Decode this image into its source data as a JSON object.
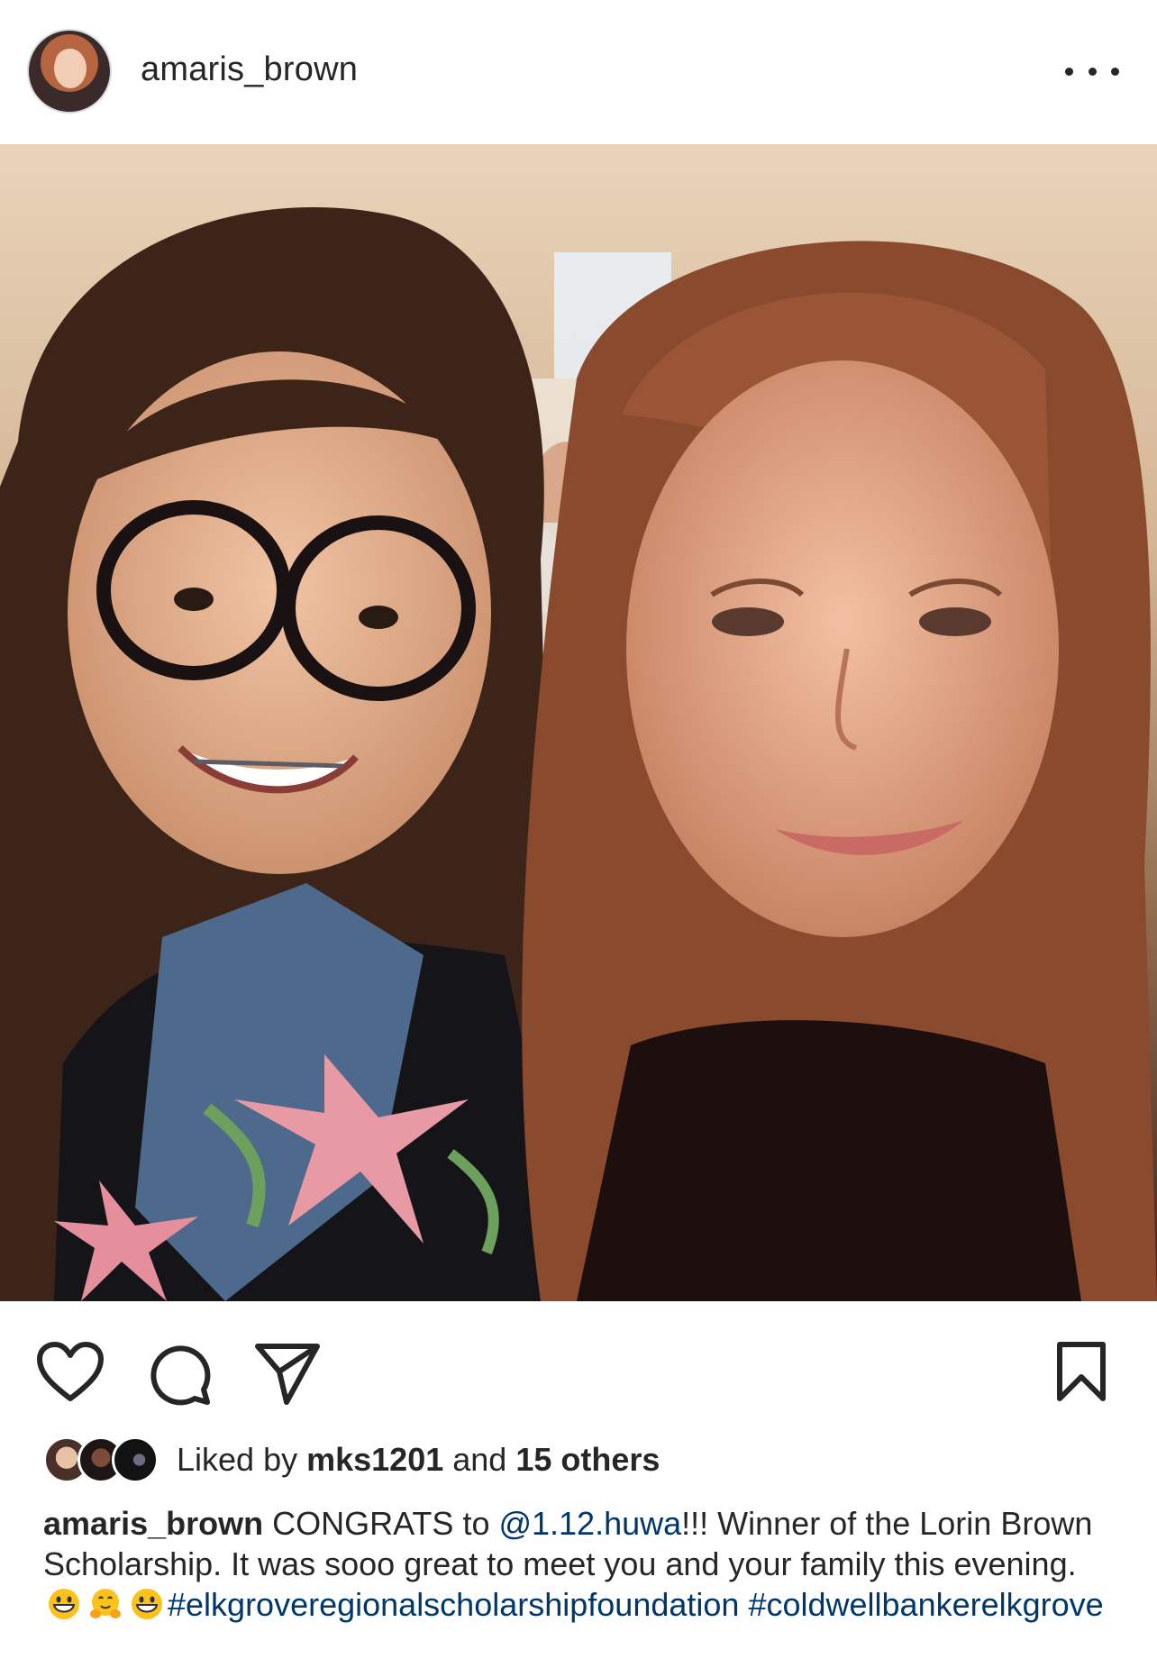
{
  "post": {
    "username": "amaris_brown",
    "avatar_icon": "profile-photo",
    "more_icon": "more-options-icon"
  },
  "photo": {
    "alt": "selfie photo"
  },
  "actions": {
    "like_icon": "heart-icon",
    "comment_icon": "comment-icon",
    "share_icon": "paper-plane-icon",
    "save_icon": "bookmark-icon"
  },
  "likes": {
    "prefix": "Liked by ",
    "user": "mks1201",
    "middle": " and ",
    "others": "15 others"
  },
  "caption": {
    "username": "amaris_brown",
    "text_1": " CONGRATS to ",
    "mention": "@1.12.huwa",
    "text_2": "!!! Winner of the Lorin Brown Scholarship. It was sooo great to meet you and your family this evening. ",
    "emoji_1": "grinning-face",
    "emoji_2": "hugging-face",
    "emoji_3": "grinning-face",
    "hashtag_1": "#elkgroveregionalscholarshipfoundation",
    "hashtag_2": "#coldwellbankerelkgrove"
  },
  "colors": {
    "text": "#262626",
    "link": "#00376b",
    "background": "#ffffff"
  }
}
